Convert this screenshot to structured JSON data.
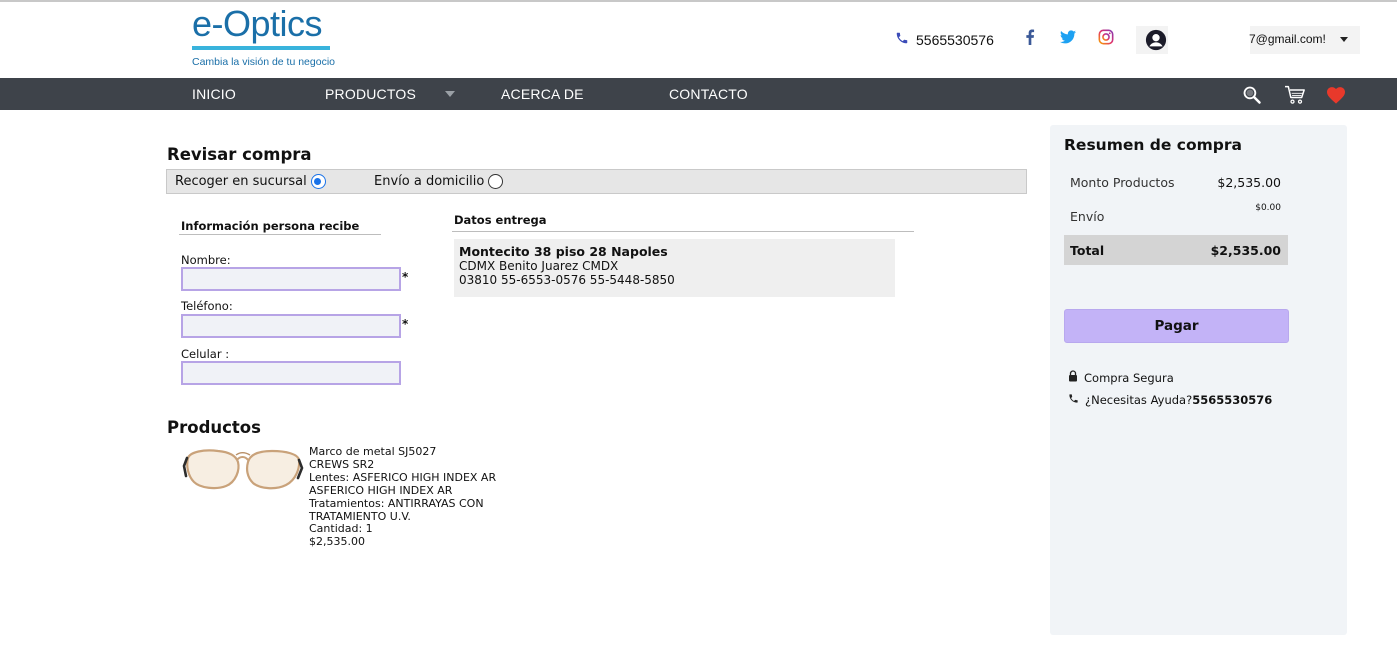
{
  "header": {
    "logo_title": "e-Optics",
    "logo_tagline": "Cambia la visión de tu negocio",
    "phone": "5565530576",
    "social": [
      "facebook-icon",
      "twitter-icon",
      "instagram-icon"
    ],
    "user_email": "7@gmail.com!"
  },
  "nav": {
    "items": [
      {
        "label": "INICIO"
      },
      {
        "label": "PRODUCTOS"
      },
      {
        "label": "ACERCA DE"
      },
      {
        "label": "CONTACTO"
      }
    ],
    "icons": [
      "search-icon",
      "cart-icon",
      "heart-icon"
    ]
  },
  "review": {
    "title": "Revisar compra",
    "option_pickup": "Recoger en sucursal",
    "option_delivery": "Envío a domicilio",
    "selected": "pickup"
  },
  "recipient": {
    "heading": "Información persona recibe",
    "name_label": "Nombre:",
    "name_value": "",
    "phone_label": "Teléfono:",
    "phone_value": "",
    "cell_label": "Celular :",
    "cell_value": "",
    "required_mark": "*"
  },
  "delivery": {
    "heading": "Datos entrega",
    "line1": "Montecito 38 piso 28 Napoles",
    "line2": "CDMX Benito Juarez CMDX",
    "line3": "03810 55-6553-0576 55-5448-5850"
  },
  "products": {
    "title": "Productos",
    "items": [
      {
        "name": "Marco de metal SJ5027",
        "model": "CREWS SR2",
        "lenses": "Lentes: ASFERICO HIGH INDEX AR ASFERICO HIGH INDEX AR",
        "treatments": "Tratamientos: ANTIRRAYAS CON TRATAMIENTO U.V.",
        "quantity": "Cantidad: 1",
        "price": "$2,535.00"
      }
    ]
  },
  "summary": {
    "title": "Resumen de compra",
    "products_label": "Monto Productos",
    "products_value": "$2,535.00",
    "shipping_label": "Envío",
    "shipping_value": "$0.00",
    "total_label": "Total",
    "total_value": "$2,535.00",
    "pay_label": "Pagar",
    "secure_label": "Compra Segura",
    "help_label": "¿Necesitas Ayuda?",
    "help_phone": "5565530576"
  },
  "colors": {
    "nav_bg": "#3e434a",
    "logo_blue": "#1a6fa8",
    "pay_button": "#c3b3f7",
    "field_border": "#b7a4e6",
    "heart": "#e8392b"
  }
}
